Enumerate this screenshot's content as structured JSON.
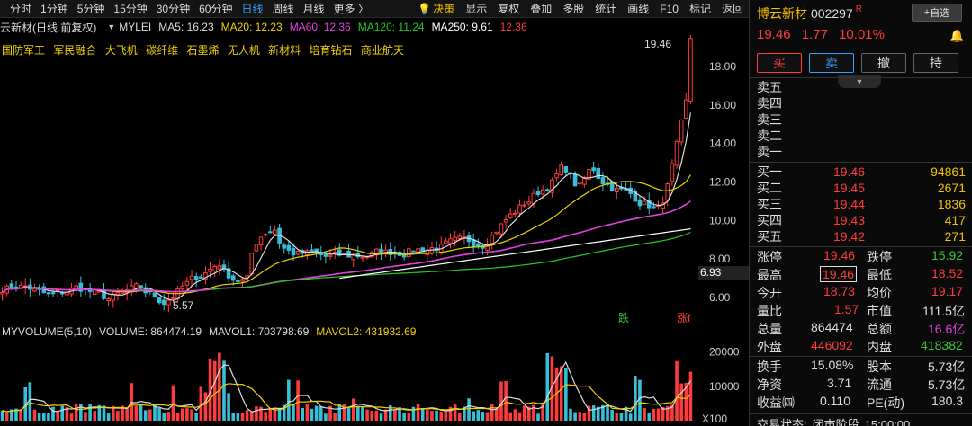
{
  "toolbar": {
    "timeframes": [
      "分时",
      "1分钟",
      "5分钟",
      "15分钟",
      "30分钟",
      "60分钟",
      "日线",
      "周线",
      "月线",
      "更多 〉"
    ],
    "active_index": 6,
    "right_items": [
      "决策",
      "显示",
      "复权",
      "叠加",
      "多股",
      "统计",
      "画线",
      "F10",
      "标记",
      "返回"
    ]
  },
  "ma_legend": {
    "title": "云新材(日线.前复权)",
    "indicator": "MYLEI",
    "ma5": "MA5: 16.23",
    "ma20": "MA20: 12.23",
    "ma60": "MA60: 12.36",
    "ma120": "MA120: 11.24",
    "ma250": "MA250: 9.61",
    "extra": "12.36"
  },
  "concepts": [
    "国防军工",
    "军民融合",
    "大飞机",
    "碳纤维",
    "石墨烯",
    "无人机",
    "新材料",
    "培育钻石",
    "商业航天"
  ],
  "price_axis": [
    "18.00",
    "16.00",
    "14.00",
    "12.00",
    "10.00",
    "8.00",
    "6.00"
  ],
  "price_axis_values": [
    18,
    16,
    14,
    12,
    10,
    8,
    6
  ],
  "marks": {
    "high_label": "19.46",
    "low_label": "5.57",
    "current_tag": "6.93",
    "die_label": "跌",
    "zhangting_label": "涨f"
  },
  "vol_info": {
    "title": "MYVOLUME(5,10)",
    "volume": "VOLUME: 864474.19",
    "mavol1": "MAVOL1: 703798.69",
    "mavol2": "MAVOL2: 431932.69"
  },
  "vol_axis": [
    "20000",
    "10000",
    "X100"
  ],
  "vol_axis_values": [
    20000,
    10000
  ],
  "stock": {
    "name": "博云新材",
    "code": "002297",
    "badge": "R",
    "price": "19.46",
    "change": "1.77",
    "pct": "10.01%",
    "select_label": "自选"
  },
  "trade_buttons": [
    "买",
    "卖",
    "撤",
    "持"
  ],
  "asks": [
    {
      "label": "卖五",
      "price": "",
      "vol": ""
    },
    {
      "label": "卖四",
      "price": "",
      "vol": ""
    },
    {
      "label": "卖三",
      "price": "",
      "vol": ""
    },
    {
      "label": "卖二",
      "price": "",
      "vol": ""
    },
    {
      "label": "卖一",
      "price": "",
      "vol": ""
    }
  ],
  "bids": [
    {
      "label": "买一",
      "price": "19.46",
      "vol": "94861"
    },
    {
      "label": "买二",
      "price": "19.45",
      "vol": "2671"
    },
    {
      "label": "买三",
      "price": "19.44",
      "vol": "1836"
    },
    {
      "label": "买四",
      "price": "19.43",
      "vol": "417"
    },
    {
      "label": "买五",
      "price": "19.42",
      "vol": "271"
    }
  ],
  "quote1": {
    "zhangting_l": "涨停",
    "zhangting_v": "19.46",
    "dieting_l": "跌停",
    "dieting_v": "15.92",
    "high_l": "最高",
    "high_v": "19.46",
    "low_l": "最低",
    "low_v": "18.52",
    "open_l": "今开",
    "open_v": "18.73",
    "avg_l": "均价",
    "avg_v": "19.17",
    "lb_l": "量比",
    "lb_v": "1.57",
    "mv_l": "市值",
    "mv_v": "111.5亿",
    "tv_l": "总量",
    "tv_v": "864474",
    "ta_l": "总额",
    "ta_v": "16.6亿",
    "wp_l": "外盘",
    "wp_v": "446092",
    "np_l": "内盘",
    "np_v": "418382"
  },
  "quote2": {
    "hs_l": "换手",
    "hs_v": "15.08%",
    "gb_l": "股本",
    "gb_v": "5.73亿",
    "jz_l": "净资",
    "jz_v": "3.71",
    "lt_l": "流通",
    "lt_v": "5.73亿",
    "sy_l": "收益㈣",
    "sy_v": "0.110",
    "pe_l": "PE(动)",
    "pe_v": "180.3"
  },
  "trade_status": {
    "label": "交易状态:",
    "value": "闭市阶段",
    "time": "15:00:00"
  },
  "colors": {
    "up": "#ff3b3b",
    "down": "#33c0d8",
    "ma5": "#dddddd",
    "ma20": "#f0d000",
    "ma60": "#e040e0",
    "ma120": "#22cc22",
    "ma250": "#ffffff",
    "accent": "#3aa0ff"
  }
}
